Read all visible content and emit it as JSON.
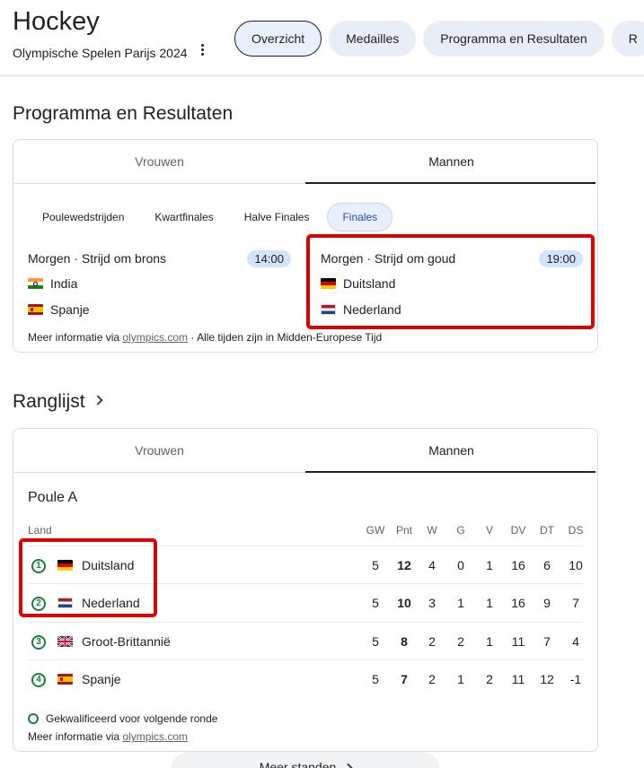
{
  "header": {
    "title": "Hockey",
    "subtitle": "Olympische Spelen Parijs 2024",
    "chips": [
      "Overzicht",
      "Medailles",
      "Programma en Resultaten",
      "R"
    ]
  },
  "schedule": {
    "title": "Programma en Resultaten",
    "tabs": [
      "Vrouwen",
      "Mannen"
    ],
    "rounds": [
      "Poulewedstrijden",
      "Kwartfinales",
      "Halve Finales",
      "Finales"
    ],
    "matches": [
      {
        "label": "Morgen · Strijd om brons",
        "time": "14:00",
        "teams": [
          "India",
          "Spanje"
        ]
      },
      {
        "label": "Morgen · Strijd om goud",
        "time": "19:00",
        "teams": [
          "Duitsland",
          "Nederland"
        ]
      }
    ],
    "footnote_prefix": "Meer informatie via ",
    "footnote_link": "olympics.com",
    "footnote_suffix": " · Alle tijden zijn in Midden-Europese Tijd"
  },
  "standings": {
    "title": "Ranglijst",
    "tabs": [
      "Vrouwen",
      "Mannen"
    ],
    "group": "Poule A",
    "columns": [
      "Land",
      "GW",
      "Pnt",
      "W",
      "G",
      "V",
      "DV",
      "DT",
      "DS"
    ],
    "rows": [
      {
        "rank": "1",
        "team": "Duitsland",
        "stats": [
          "5",
          "12",
          "4",
          "0",
          "1",
          "16",
          "6",
          "10"
        ]
      },
      {
        "rank": "2",
        "team": "Nederland",
        "stats": [
          "5",
          "10",
          "3",
          "1",
          "1",
          "16",
          "9",
          "7"
        ]
      },
      {
        "rank": "3",
        "team": "Groot-Brittannië",
        "stats": [
          "5",
          "8",
          "2",
          "2",
          "1",
          "11",
          "7",
          "4"
        ]
      },
      {
        "rank": "4",
        "team": "Spanje",
        "stats": [
          "5",
          "7",
          "2",
          "1",
          "2",
          "11",
          "12",
          "-1"
        ]
      }
    ],
    "legend": "Gekwalificeerd voor volgende ronde",
    "footnote_prefix": "Meer informatie via ",
    "footnote_link": "olympics.com",
    "more_button": "Meer standen"
  }
}
